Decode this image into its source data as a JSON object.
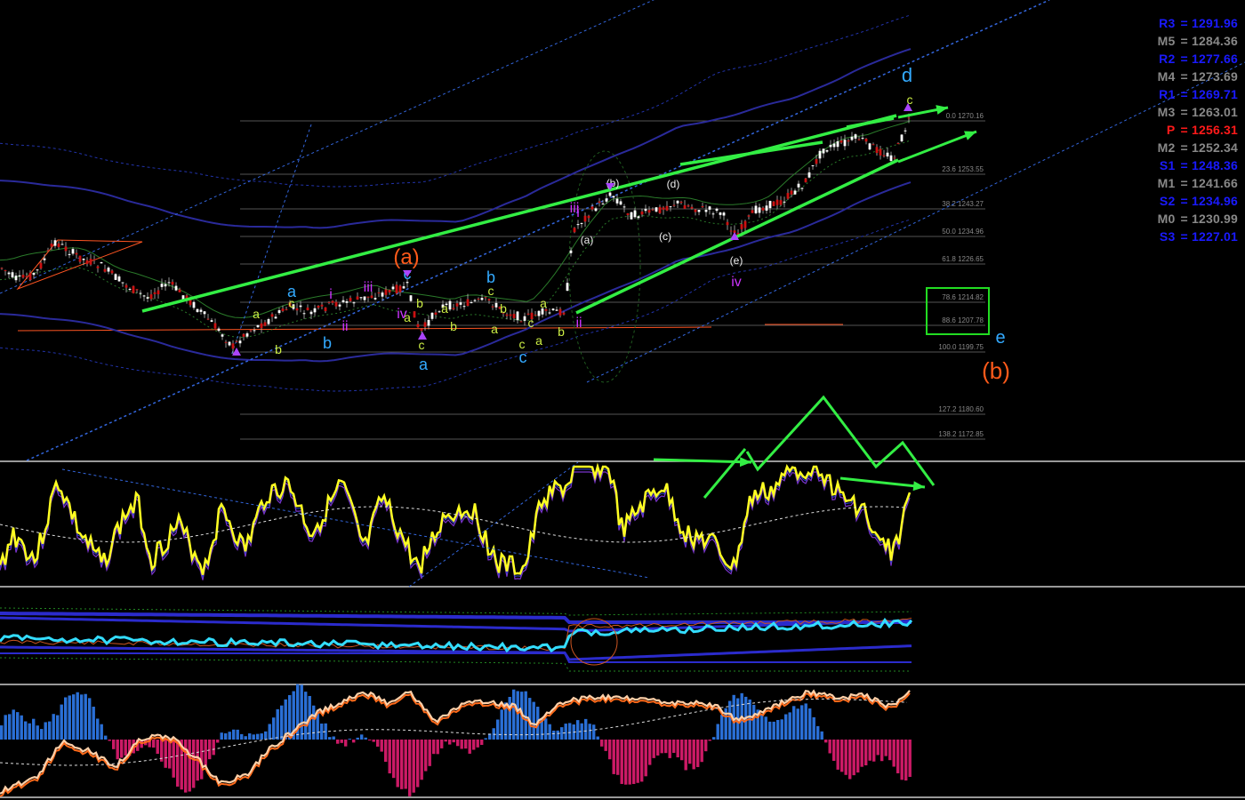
{
  "colors": {
    "background": "#000000",
    "trendline": "#33ee44",
    "fib": "#555555",
    "resistance": "#1a1aff",
    "midpoint": "#888888",
    "pivot": "#ff1a1a",
    "support": "#1a1aff",
    "oscillator": "#ffff22",
    "cyan_line": "#33ddff",
    "hist_pos": "#2a6fd6",
    "hist_neg": "#cc1a66",
    "orange_line": "#ff6a1a",
    "peach_line": "#ffd0a8"
  },
  "pivots": [
    {
      "label": "R3",
      "value": "= 1291.96",
      "kind": "resistance"
    },
    {
      "label": "M5",
      "value": "= 1284.36",
      "kind": "midpoint"
    },
    {
      "label": "R2",
      "value": "= 1277.66",
      "kind": "resistance"
    },
    {
      "label": "M4",
      "value": "= 1273.69",
      "kind": "midpoint"
    },
    {
      "label": "R1",
      "value": "= 1269.71",
      "kind": "resistance"
    },
    {
      "label": "M3",
      "value": "= 1263.01",
      "kind": "midpoint"
    },
    {
      "label": "P",
      "value": "= 1256.31",
      "kind": "pivot"
    },
    {
      "label": "M2",
      "value": "= 1252.34",
      "kind": "midpoint"
    },
    {
      "label": "S1",
      "value": "= 1248.36",
      "kind": "support"
    },
    {
      "label": "M1",
      "value": "= 1241.66",
      "kind": "midpoint"
    },
    {
      "label": "S2",
      "value": "= 1234.96",
      "kind": "support"
    },
    {
      "label": "M0",
      "value": "= 1230.99",
      "kind": "midpoint"
    },
    {
      "label": "S3",
      "value": "= 1227.01",
      "kind": "support"
    }
  ],
  "fib_levels": [
    {
      "label": "0.0 1270.16"
    },
    {
      "label": "23.6 1253.55"
    },
    {
      "label": "38.2 1243.27"
    },
    {
      "label": "50.0 1234.96"
    },
    {
      "label": "61.8 1226.65"
    },
    {
      "label": "78.6 1214.82"
    },
    {
      "label": "88.6 1207.78"
    },
    {
      "label": "100.0 1199.75"
    },
    {
      "label": "127.2 1180.60"
    },
    {
      "label": "138.2 1172.85"
    }
  ],
  "wave_labels": [
    {
      "text": "(a)",
      "color": "#ff5a1a",
      "size": 24
    },
    {
      "text": "(b)",
      "color": "#ff5a1a",
      "size": 26
    },
    {
      "text": "d",
      "color": "#33aaff",
      "size": 22
    },
    {
      "text": "e",
      "color": "#33aaff",
      "size": 20
    },
    {
      "text": "c",
      "color": "#33aaff",
      "size": 18
    },
    {
      "text": "a",
      "color": "#33aaff",
      "size": 18
    },
    {
      "text": "b",
      "color": "#33aaff",
      "size": 18
    },
    {
      "text": "a",
      "color": "#33aaff",
      "size": 18
    },
    {
      "text": "b",
      "color": "#33aaff",
      "size": 18
    },
    {
      "text": "c",
      "color": "#33aaff",
      "size": 18
    },
    {
      "text": "i",
      "color": "#cc33ff",
      "size": 16
    },
    {
      "text": "ii",
      "color": "#cc33ff",
      "size": 16
    },
    {
      "text": "iii",
      "color": "#cc33ff",
      "size": 16
    },
    {
      "text": "iv",
      "color": "#cc33ff",
      "size": 16
    },
    {
      "text": "i",
      "color": "#cc33ff",
      "size": 16
    },
    {
      "text": "ii",
      "color": "#cc33ff",
      "size": 16
    },
    {
      "text": "iii",
      "color": "#cc33ff",
      "size": 16
    },
    {
      "text": "iv",
      "color": "#cc33ff",
      "size": 16
    },
    {
      "text": "(a)",
      "color": "#eeeeee",
      "size": 12
    },
    {
      "text": "(b)",
      "color": "#eeeeee",
      "size": 12
    },
    {
      "text": "(c)",
      "color": "#eeeeee",
      "size": 12
    },
    {
      "text": "(d)",
      "color": "#eeeeee",
      "size": 12
    },
    {
      "text": "(e)",
      "color": "#eeeeee",
      "size": 12
    },
    {
      "text": "c",
      "color": "#ccee44",
      "size": 14
    },
    {
      "text": "a",
      "color": "#ccee44",
      "size": 14
    },
    {
      "text": "b",
      "color": "#ccee44",
      "size": 14
    },
    {
      "text": "c",
      "color": "#ccee44",
      "size": 14
    },
    {
      "text": "a",
      "color": "#ccee44",
      "size": 14
    },
    {
      "text": "b",
      "color": "#ccee44",
      "size": 14
    },
    {
      "text": "a",
      "color": "#ccee44",
      "size": 14
    },
    {
      "text": "b",
      "color": "#ccee44",
      "size": 14
    },
    {
      "text": "c",
      "color": "#ccee44",
      "size": 14
    },
    {
      "text": "b",
      "color": "#ccee44",
      "size": 14
    },
    {
      "text": "a",
      "color": "#ccee44",
      "size": 14
    },
    {
      "text": "c",
      "color": "#ccee44",
      "size": 14
    },
    {
      "text": "a",
      "color": "#ccee44",
      "size": 14
    },
    {
      "text": "b",
      "color": "#ccee44",
      "size": 14
    },
    {
      "text": "c",
      "color": "#ccee44",
      "size": 14
    },
    {
      "text": "a",
      "color": "#ccee44",
      "size": 14
    },
    {
      "text": "c",
      "color": "#ccee44",
      "size": 14
    }
  ],
  "chart_data": {
    "type": "line",
    "panels": [
      "price",
      "oscillator",
      "bands",
      "histogram"
    ],
    "price_scale": {
      "top": 1270.16,
      "bottom": 1172.85
    },
    "grid": false,
    "legend": "none"
  }
}
